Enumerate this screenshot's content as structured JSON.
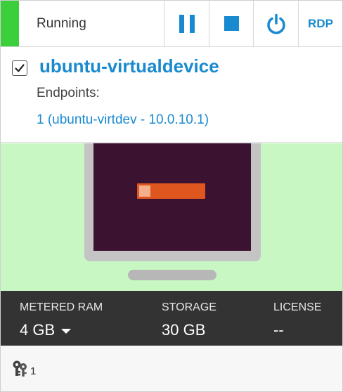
{
  "status": {
    "label": "Running",
    "color": "#3ccf3c"
  },
  "toolbar": {
    "pause_icon": "pause-icon",
    "stop_icon": "stop-icon",
    "power_icon": "power-icon",
    "rdp_label": "RDP",
    "accent": "#1a8ad0"
  },
  "vm": {
    "selected": true,
    "name": "ubuntu-virtualdevice",
    "endpoints_label": "Endpoints:",
    "endpoint_link": "1 (ubuntu-virtdev - 10.0.10.1)"
  },
  "specs": {
    "ram_label": "METERED RAM",
    "ram_value": "4 GB",
    "storage_label": "STORAGE",
    "storage_value": "30 GB",
    "license_label": "LICENSE",
    "license_value": "--"
  },
  "footer": {
    "keys_icon": "keys-icon",
    "keys_count": "1"
  },
  "colors": {
    "preview_bg": "#c9f7c4",
    "specs_bg": "#333333"
  }
}
